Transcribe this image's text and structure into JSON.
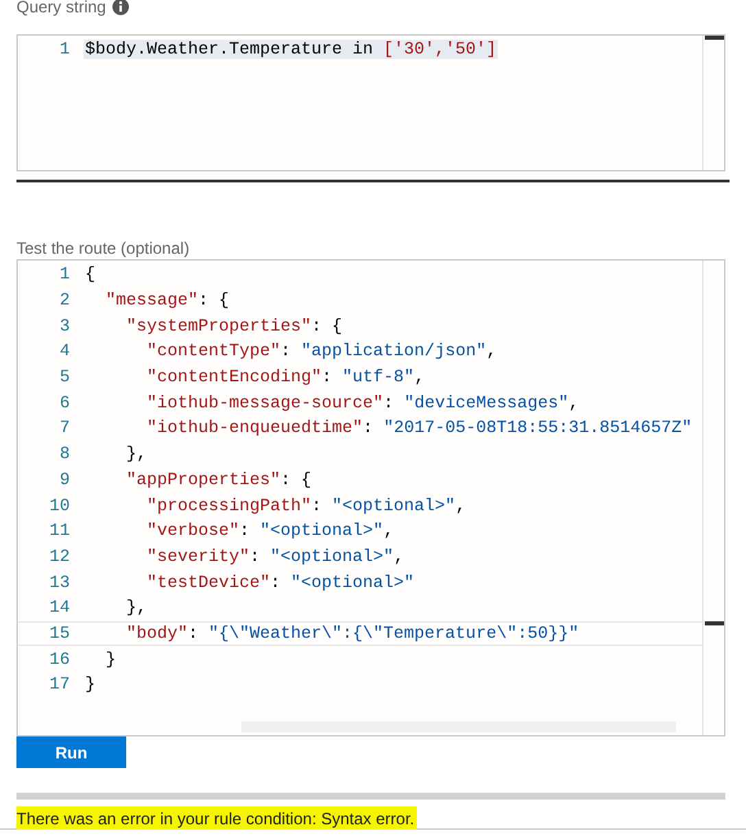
{
  "query": {
    "label": "Query string",
    "lines": [
      {
        "number": "1",
        "selected": true,
        "tokens": [
          {
            "kind": "plain",
            "text": "$body.Weather.Temperature in "
          },
          {
            "kind": "key",
            "text": "['30','50']"
          }
        ]
      }
    ]
  },
  "test": {
    "label": "Test the route (optional)",
    "lines": [
      {
        "number": "1",
        "current": false,
        "tokens": [
          {
            "kind": "plain",
            "text": "{"
          }
        ]
      },
      {
        "number": "2",
        "current": false,
        "tokens": [
          {
            "kind": "key",
            "text": "  \"message\""
          },
          {
            "kind": "plain",
            "text": ": {"
          }
        ]
      },
      {
        "number": "3",
        "current": false,
        "tokens": [
          {
            "kind": "key",
            "text": "    \"systemProperties\""
          },
          {
            "kind": "plain",
            "text": ": {"
          }
        ]
      },
      {
        "number": "4",
        "current": false,
        "tokens": [
          {
            "kind": "key",
            "text": "      \"contentType\""
          },
          {
            "kind": "plain",
            "text": ": "
          },
          {
            "kind": "string",
            "text": "\"application/json\""
          },
          {
            "kind": "plain",
            "text": ","
          }
        ]
      },
      {
        "number": "5",
        "current": false,
        "tokens": [
          {
            "kind": "key",
            "text": "      \"contentEncoding\""
          },
          {
            "kind": "plain",
            "text": ": "
          },
          {
            "kind": "string",
            "text": "\"utf-8\""
          },
          {
            "kind": "plain",
            "text": ","
          }
        ]
      },
      {
        "number": "6",
        "current": false,
        "tokens": [
          {
            "kind": "key",
            "text": "      \"iothub-message-source\""
          },
          {
            "kind": "plain",
            "text": ": "
          },
          {
            "kind": "string",
            "text": "\"deviceMessages\""
          },
          {
            "kind": "plain",
            "text": ","
          }
        ]
      },
      {
        "number": "7",
        "current": false,
        "tokens": [
          {
            "kind": "key",
            "text": "      \"iothub-enqueuedtime\""
          },
          {
            "kind": "plain",
            "text": ": "
          },
          {
            "kind": "string",
            "text": "\"2017-05-08T18:55:31.8514657Z\""
          }
        ]
      },
      {
        "number": "8",
        "current": false,
        "tokens": [
          {
            "kind": "plain",
            "text": "    },"
          }
        ]
      },
      {
        "number": "9",
        "current": false,
        "tokens": [
          {
            "kind": "key",
            "text": "    \"appProperties\""
          },
          {
            "kind": "plain",
            "text": ": {"
          }
        ]
      },
      {
        "number": "10",
        "current": false,
        "tokens": [
          {
            "kind": "key",
            "text": "      \"processingPath\""
          },
          {
            "kind": "plain",
            "text": ": "
          },
          {
            "kind": "string",
            "text": "\"<optional>\""
          },
          {
            "kind": "plain",
            "text": ","
          }
        ]
      },
      {
        "number": "11",
        "current": false,
        "tokens": [
          {
            "kind": "key",
            "text": "      \"verbose\""
          },
          {
            "kind": "plain",
            "text": ": "
          },
          {
            "kind": "string",
            "text": "\"<optional>\""
          },
          {
            "kind": "plain",
            "text": ","
          }
        ]
      },
      {
        "number": "12",
        "current": false,
        "tokens": [
          {
            "kind": "key",
            "text": "      \"severity\""
          },
          {
            "kind": "plain",
            "text": ": "
          },
          {
            "kind": "string",
            "text": "\"<optional>\""
          },
          {
            "kind": "plain",
            "text": ","
          }
        ]
      },
      {
        "number": "13",
        "current": false,
        "tokens": [
          {
            "kind": "key",
            "text": "      \"testDevice\""
          },
          {
            "kind": "plain",
            "text": ": "
          },
          {
            "kind": "string",
            "text": "\"<optional>\""
          }
        ]
      },
      {
        "number": "14",
        "current": false,
        "tokens": [
          {
            "kind": "plain",
            "text": "    },"
          }
        ]
      },
      {
        "number": "15",
        "current": true,
        "tokens": [
          {
            "kind": "key",
            "text": "    \"body\""
          },
          {
            "kind": "plain",
            "text": ": "
          },
          {
            "kind": "string",
            "text": "\"{\\\"Weather\\\":{\\\"Temperature\\\":50}}\""
          }
        ]
      },
      {
        "number": "16",
        "current": false,
        "tokens": [
          {
            "kind": "plain",
            "text": "  }"
          }
        ]
      },
      {
        "number": "17",
        "current": false,
        "tokens": [
          {
            "kind": "plain",
            "text": "}"
          }
        ]
      }
    ]
  },
  "run_button": "Run",
  "error": "There was an error in your rule condition: Syntax error."
}
